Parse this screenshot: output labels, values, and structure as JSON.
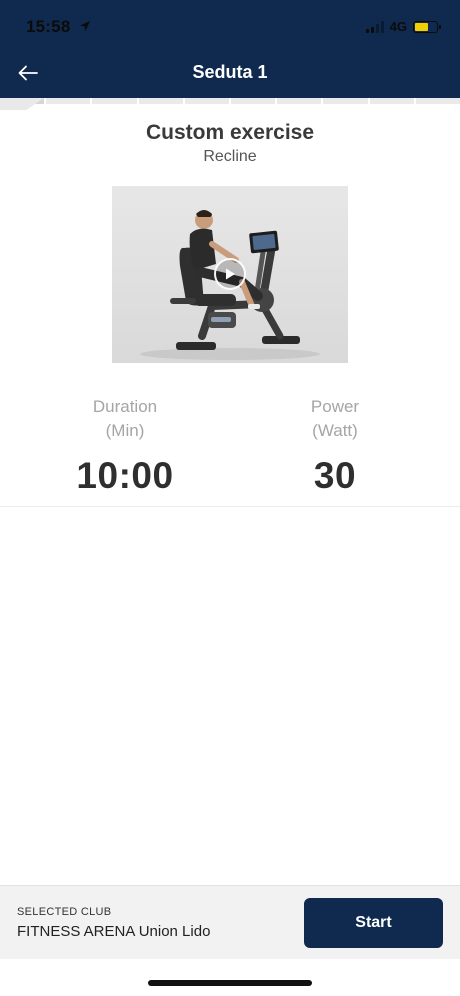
{
  "status_bar": {
    "time": "15:58",
    "network": "4G",
    "icons": {
      "location": "location-arrow-icon",
      "signal": "signal-bars-icon",
      "battery": "battery-icon"
    },
    "battery_color": "#f2d000"
  },
  "header": {
    "title": "Seduta 1",
    "back_icon": "arrow-left-icon",
    "background": "#0f2a4e"
  },
  "exercise": {
    "title": "Custom exercise",
    "subtitle": "Recline",
    "video_icon": "play-icon"
  },
  "stats": {
    "duration": {
      "label_line1": "Duration",
      "label_line2": "(Min)",
      "value": "10:00"
    },
    "power": {
      "label_line1": "Power",
      "label_line2": "(Watt)",
      "value": "30"
    }
  },
  "footer": {
    "club_caption": "SELECTED CLUB",
    "club_name": "FITNESS ARENA Union Lido",
    "start_label": "Start",
    "accent": "#0f2a4e"
  }
}
